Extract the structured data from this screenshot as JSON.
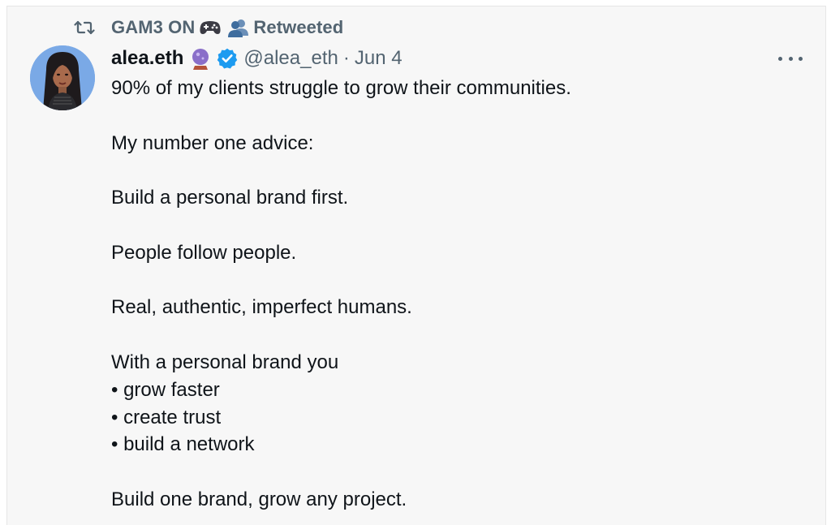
{
  "retweet": {
    "icon": "retweet-icon",
    "user": "GAM3 ON",
    "emoji_1": "game-controller-icon",
    "emoji_2": "busts-in-silhouette-icon",
    "label": "Retweeted"
  },
  "author": {
    "avatar": "avatar-image",
    "display_name": "alea.eth",
    "name_emoji": "crystal-ball-icon",
    "verified_icon": "verified-badge-icon",
    "handle": "@alea_eth",
    "separator": "·",
    "date": "Jun 4"
  },
  "menu": {
    "icon": "more-options-icon"
  },
  "tweet": {
    "lines": [
      "90% of my clients struggle to grow their communities.",
      "",
      "My number one advice:",
      "",
      "Build a personal brand first.",
      "",
      "People follow people.",
      "",
      "Real, authentic, imperfect humans.",
      "",
      "With a personal brand you",
      "• grow faster",
      "• create trust",
      "• build a network",
      "",
      "Build one brand, grow any project."
    ]
  },
  "colors": {
    "card_bg": "#f7f7f7",
    "text_primary": "#0f1419",
    "text_secondary": "#536471",
    "verified_blue": "#1d9bf0"
  }
}
